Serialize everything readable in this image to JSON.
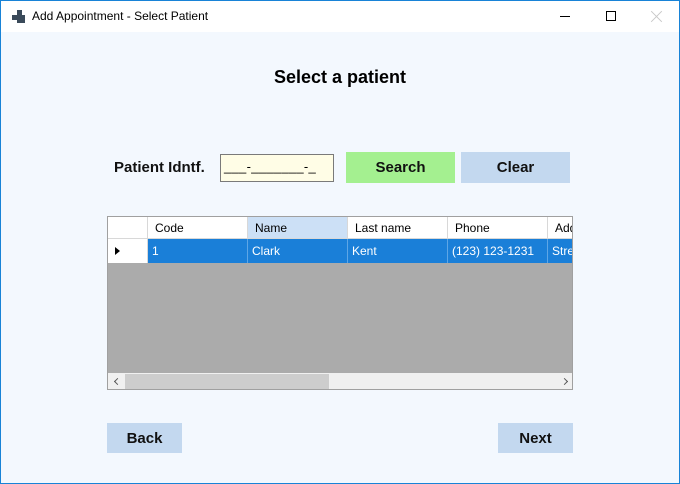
{
  "window": {
    "title": "Add Appointment - Select Patient",
    "icons": {
      "app": "windows-form-icon",
      "minimize": "minimize-icon",
      "maximize": "maximize-icon",
      "close": "close-icon"
    }
  },
  "main": {
    "heading": "Select a patient",
    "search": {
      "label": "Patient Idntf.",
      "value": "___-_______-_",
      "search_label": "Search",
      "clear_label": "Clear"
    },
    "grid": {
      "columns": [
        "Code",
        "Name",
        "Last name",
        "Phone",
        "Address"
      ],
      "visible_columns": [
        "Code",
        "Name",
        "Last name",
        "Phone",
        "Add"
      ],
      "selected_column": "Name",
      "rows": [
        {
          "code": "1",
          "name": "Clark",
          "last_name": "Kent",
          "phone": "(123) 123-1231",
          "address": "Stree"
        }
      ]
    },
    "nav": {
      "back_label": "Back",
      "next_label": "Next"
    }
  },
  "colors": {
    "search_button": "#a4f090",
    "clear_button": "#c3d8ef",
    "nav_buttons": "#c3d8ef",
    "selection": "#1a7fd8",
    "input_bg": "#fffde6",
    "grid_bg": "#ababab",
    "window_border": "#1883d7"
  }
}
